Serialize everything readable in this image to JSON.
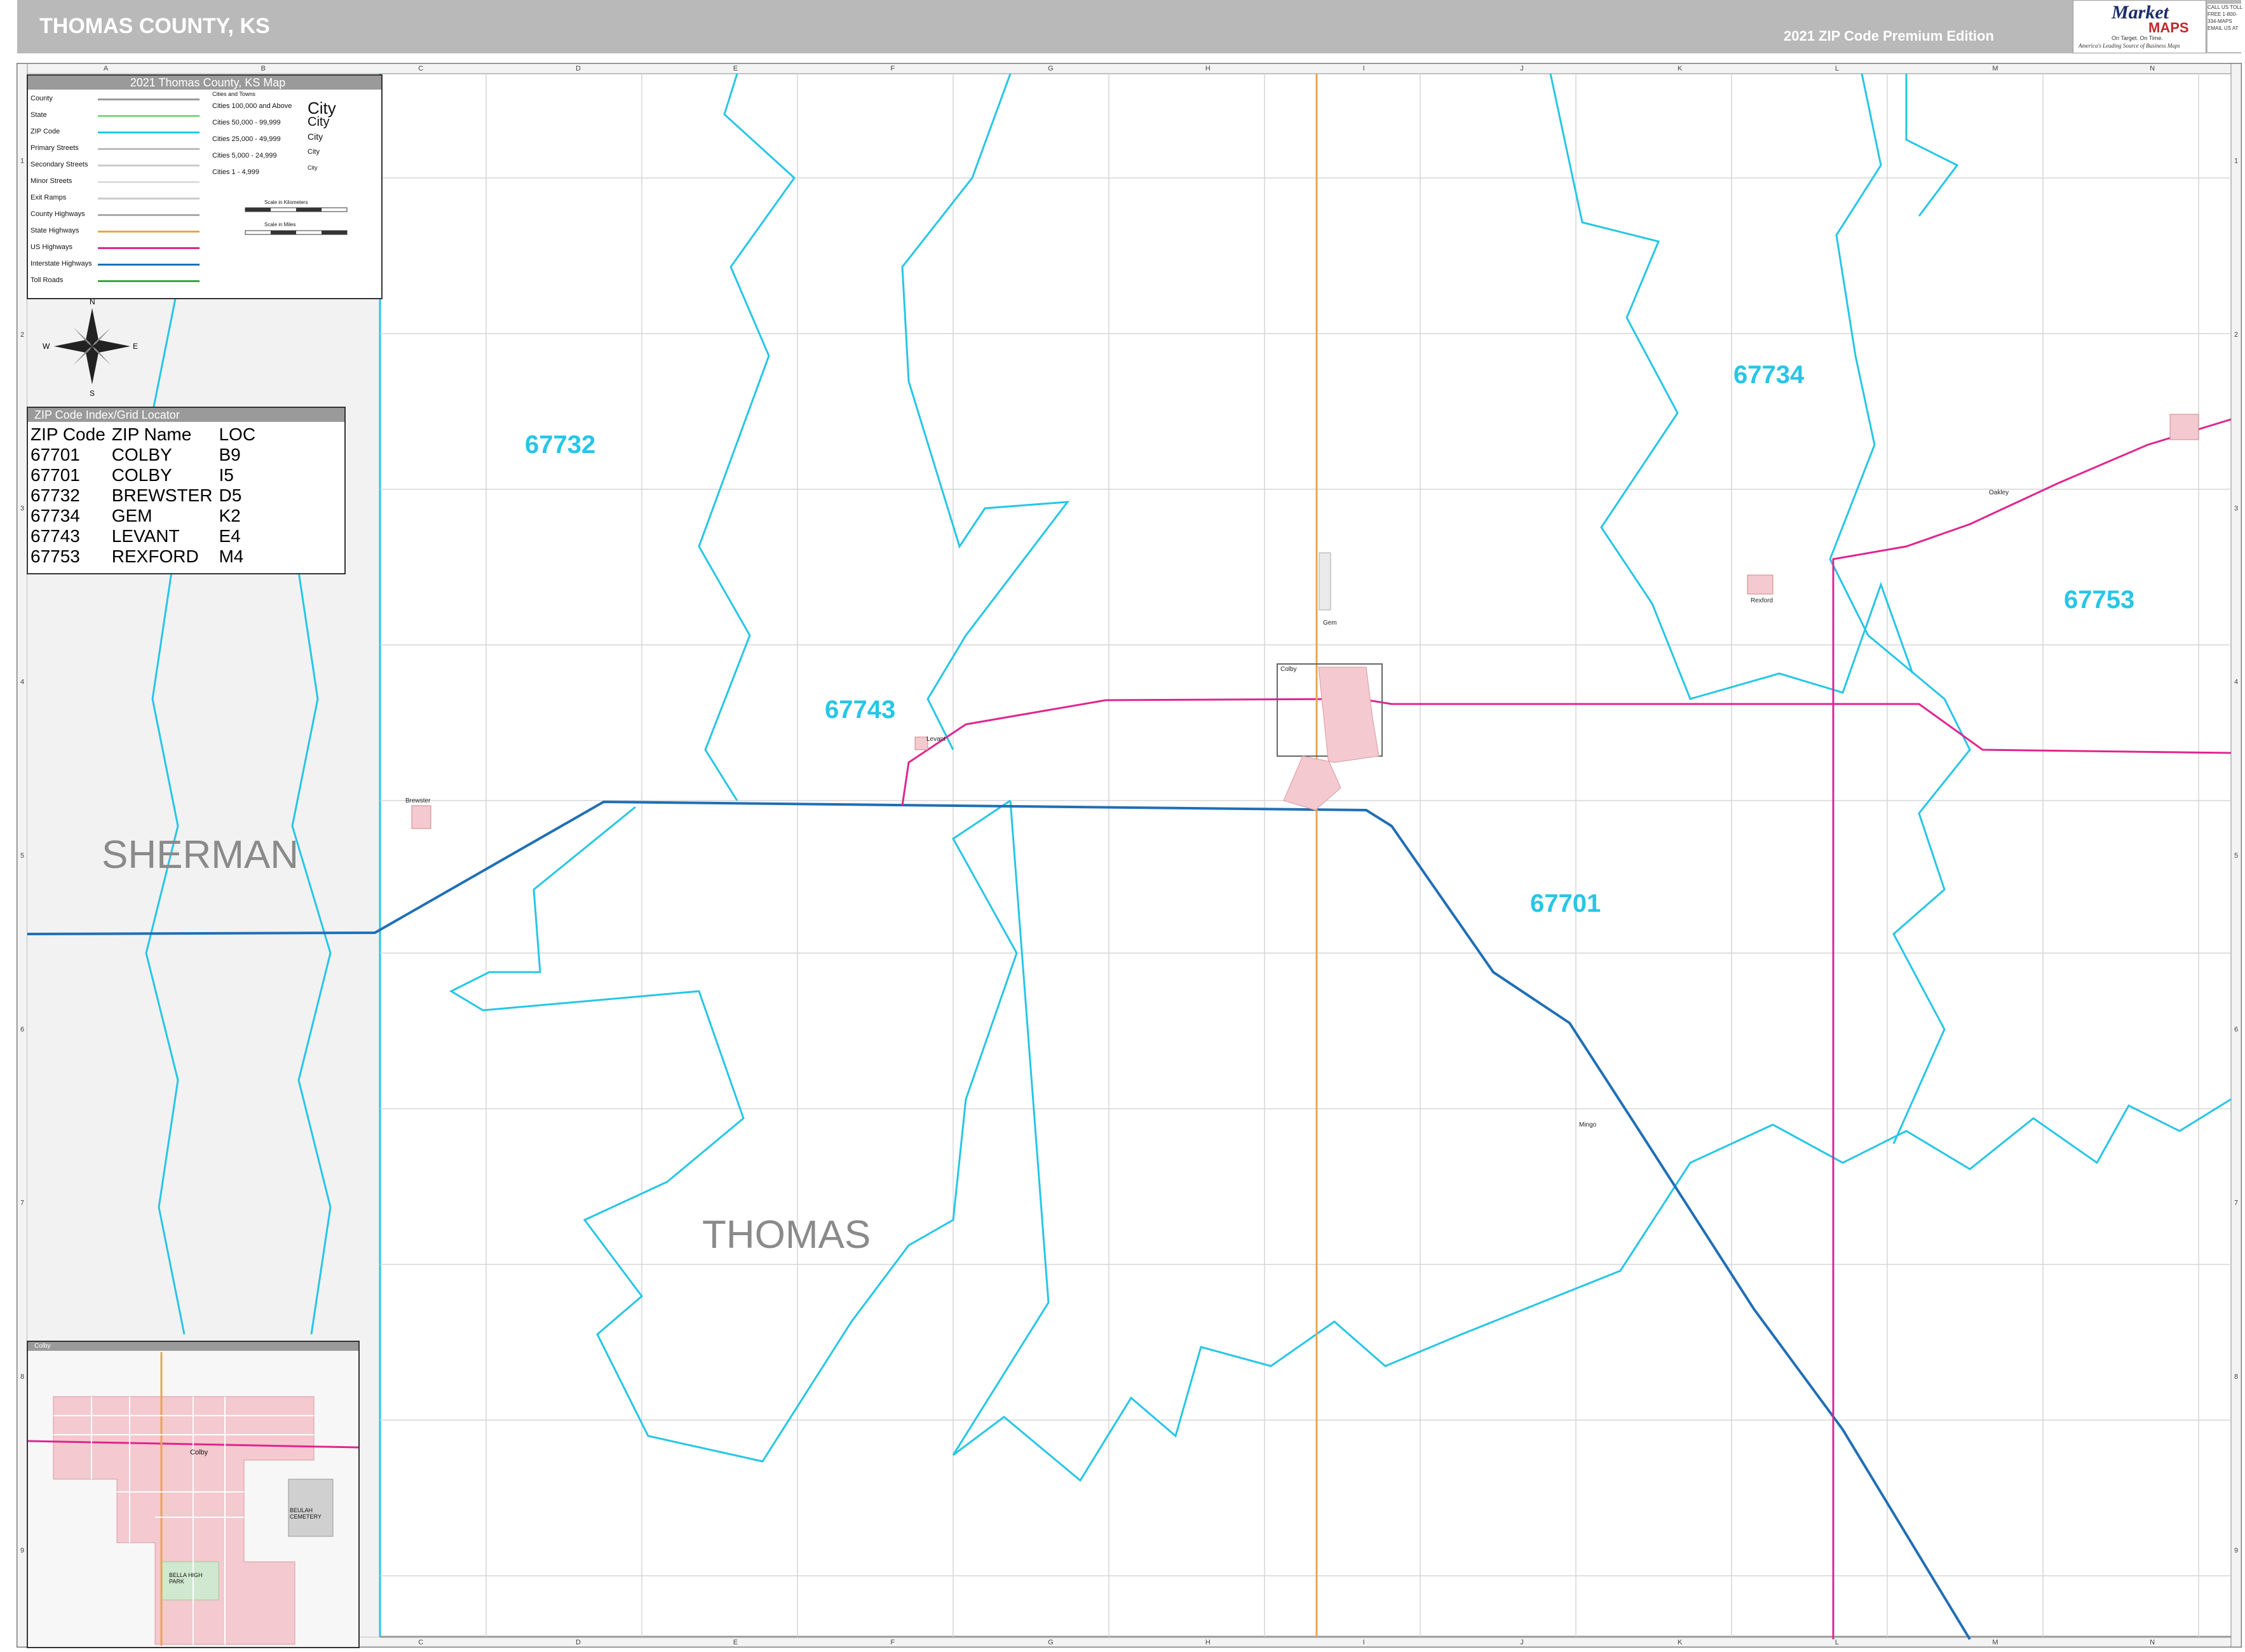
{
  "header": {
    "title": "THOMAS COUNTY, KS",
    "edition": "2021 ZIP Code Premium Edition",
    "logo_word1": "Market",
    "logo_word2": "MAPS",
    "logo_slogan": "On Target. On Time.",
    "logo_tagline": "America's Leading Source of Business Maps",
    "contact": "CALL US TOLL FREE 1-800-334-MAPS EMAIL US AT"
  },
  "legend": {
    "title": "2021 Thomas County, KS Map",
    "line_items": [
      "County",
      "State",
      "ZIP Code",
      "Primary Streets",
      "Secondary Streets",
      "Minor Streets",
      "Exit Ramps",
      "County Highways",
      "State Highways",
      "US Highways",
      "Interstate Highways",
      "Toll Roads"
    ],
    "cities_title": "Cities and Towns",
    "city_classes": [
      "Cities 100,000 and Above",
      "Cities 50,000 - 99,999",
      "Cities 25,000 - 49,999",
      "Cities 5,000 - 24,999",
      "Cities 1 - 4,999"
    ],
    "city_samples": [
      "City",
      "City",
      "City",
      "City",
      "City"
    ],
    "scale_km": "Scale in Kilometers",
    "scale_mi": "Scale in Miles",
    "line_colors": [
      "#9a9a9a",
      "#7dd87d",
      "#26c6e6",
      "#bbbbbb",
      "#cccccc",
      "#dddddd",
      "#cccccc",
      "#aaaaaa",
      "#e8a64a",
      "#e0258f",
      "#1f6fb5",
      "#3aa63a"
    ]
  },
  "compass": {
    "n": "N",
    "s": "S",
    "e": "E",
    "w": "W"
  },
  "zip_index": {
    "title": "ZIP Code Index/Grid Locator",
    "headers": [
      "ZIP Code",
      "ZIP Name",
      "LOC"
    ],
    "rows": [
      [
        "67701",
        "COLBY",
        "B9"
      ],
      [
        "67701",
        "COLBY",
        "I5"
      ],
      [
        "67732",
        "BREWSTER",
        "D5"
      ],
      [
        "67734",
        "GEM",
        "K2"
      ],
      [
        "67743",
        "LEVANT",
        "E4"
      ],
      [
        "67753",
        "REXFORD",
        "M4"
      ]
    ]
  },
  "inset": {
    "title": "Colby",
    "town_label": "Colby",
    "cemetery": "BEULAH CEMETERY",
    "park": "BELLA HIGH PARK"
  },
  "map": {
    "zip_labels": [
      "67732",
      "67734",
      "67743",
      "67753",
      "67701"
    ],
    "county_labels": [
      "SHERMAN",
      "THOMAS"
    ],
    "places": [
      "Brewster",
      "Levant",
      "Colby",
      "Gem",
      "Rexford",
      "Mingo",
      "Oakley"
    ],
    "grid_cols": [
      "A",
      "B",
      "C",
      "D",
      "E",
      "F",
      "G",
      "H",
      "I",
      "J",
      "K",
      "L",
      "M",
      "N"
    ],
    "grid_rows": [
      "1",
      "2",
      "3",
      "4",
      "5",
      "6",
      "7",
      "8",
      "9"
    ],
    "colors": {
      "zip_boundary": "#26c6e6",
      "interstate": "#1f6fb5",
      "us_highway": "#e0258f",
      "state_highway": "#e8a64a",
      "city_fill": "#f4c9cf",
      "sherman_fill": "#f2f2f2"
    }
  }
}
